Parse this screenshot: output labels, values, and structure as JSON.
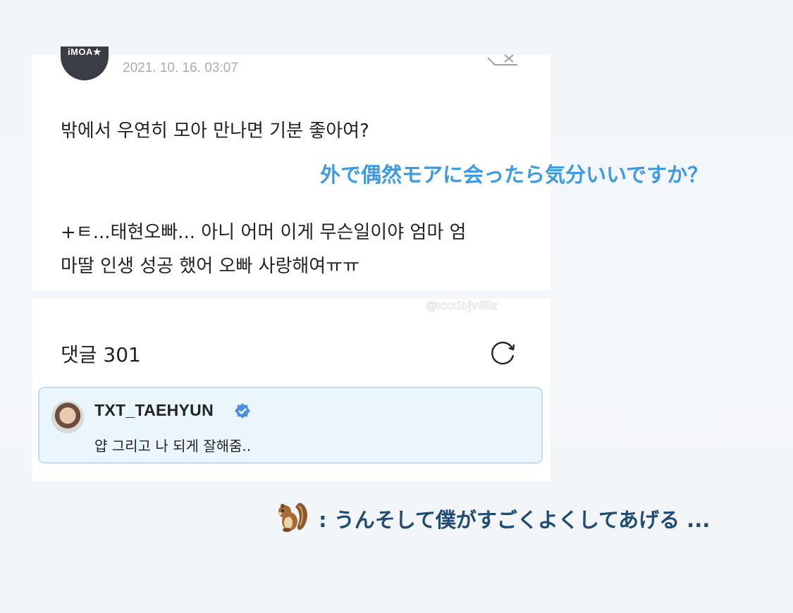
{
  "post": {
    "avatar_label": "iMOA★",
    "timestamp": "2021. 10. 16. 03:07",
    "line1": "밖에서 우연히 모아 만나면 기분 좋아여?",
    "line2": "+ㅌ...태현오빠... 아니 어머 이게 무슨일이야 엄마 엄",
    "line3": "마딸 인생 성공 했어 오빠 사랑해여ㅠㅠ"
  },
  "translation_question": "外で偶然モアに会ったら気分いいですか？",
  "comments": {
    "watermark": "@xxxibjv95z",
    "count_label": "댓글 301",
    "featured": {
      "username": "TXT_TAEHYUN",
      "text": "얍 그리고 나 되게 잘해줌.."
    }
  },
  "translation_answer": ": うんそして僕がすごくよくしてあげる ...",
  "icons": {
    "share": "share-icon",
    "refresh": "refresh-icon",
    "verified": "verified-badge-icon",
    "emoji": "chipmunk-emoji"
  },
  "colors": {
    "jp_question": "#3c9be3",
    "jp_answer": "#1f4b74",
    "verified": "#4a90e2",
    "comment_bg": "#eaf5fc"
  }
}
